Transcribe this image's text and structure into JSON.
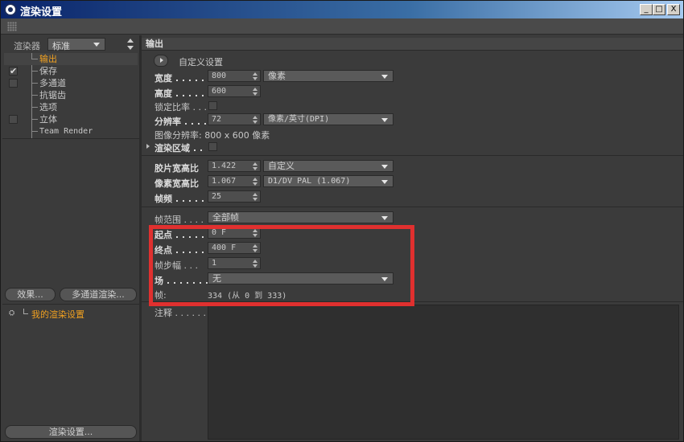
{
  "window": {
    "title": "渲染设置"
  },
  "titlebar_buttons": [
    "_",
    "□",
    "X"
  ],
  "left": {
    "renderer_label": "渲染器",
    "renderer_value": "标准",
    "tree": [
      {
        "label": "输出",
        "checked": null,
        "active": true
      },
      {
        "label": "保存",
        "checked": true,
        "active": false
      },
      {
        "label": "多通道",
        "checked": false,
        "active": false
      },
      {
        "label": "抗锯齿",
        "checked": null,
        "active": false
      },
      {
        "label": "选项",
        "checked": null,
        "active": false
      },
      {
        "label": "立体",
        "checked": false,
        "active": false
      },
      {
        "label": "Team Render",
        "checked": null,
        "active": false
      }
    ],
    "effects_button": "效果...",
    "multipass_button": "多通道渲染...",
    "preset_label": "我的渲染设置",
    "render_settings_button": "渲染设置..."
  },
  "right": {
    "section_title": "输出",
    "custom_settings": "自定义设置",
    "width_label": "宽度",
    "width_value": "800",
    "unit_value": "像素",
    "height_label": "高度",
    "height_value": "600",
    "lock_ratio_label": "锁定比率",
    "resolution_label": "分辨率",
    "resolution_value": "72",
    "resolution_unit": "像素/英寸(DPI)",
    "image_resolution": "图像分辨率: 800 x 600 像素",
    "render_region_label": "渲染区域",
    "film_aspect_label": "胶片宽高比",
    "film_aspect_value": "1.422",
    "film_aspect_preset": "自定义",
    "pixel_aspect_label": "像素宽高比",
    "pixel_aspect_value": "1.067",
    "pixel_aspect_preset": "D1/DV PAL (1.067)",
    "fps_label": "帧频",
    "fps_value": "25",
    "frame_range_label": "帧范围",
    "frame_range_value": "全部帧",
    "start_label": "起点",
    "start_value": "0 F",
    "end_label": "终点",
    "end_value": "400 F",
    "frame_step_label": "帧步幅",
    "frame_step_value": "1",
    "field_label": "场",
    "field_value": "无",
    "frames_label": "帧:",
    "frames_value": "334 (从 0 到 333)",
    "notes_label": "注释"
  },
  "colors": {
    "highlight": "#e0302f",
    "active_item": "#f0a020"
  }
}
